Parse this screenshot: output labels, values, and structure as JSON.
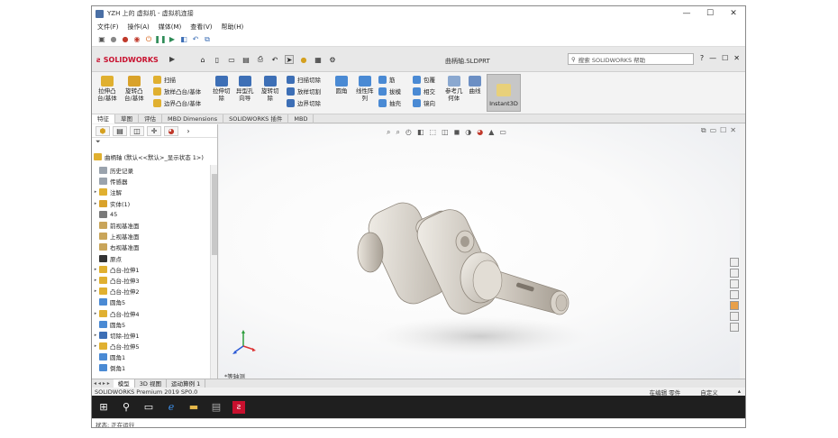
{
  "window": {
    "title": "YZH 上的 虚拟机 - 虚拟机连接",
    "controls": [
      "—",
      "☐",
      "✕"
    ]
  },
  "vm_menu": [
    "文件(F)",
    "操作(A)",
    "媒体(M)",
    "查看(V)",
    "帮助(H)"
  ],
  "sw": {
    "brand": "SOLIDWORKS",
    "document_title": "曲柄轴.SLDPRT",
    "search_placeholder": "搜索 SOLIDWORKS 帮助",
    "help_controls": [
      "?",
      "—",
      "☐",
      "✕"
    ]
  },
  "ribbon": {
    "boss_extrude": "拉伸凸\n台/基体",
    "boss_revolve": "旋转凸\n台/基体",
    "sweep": "扫描",
    "loft": "放样凸台/基体",
    "boundary": "边界凸台/基体",
    "cut_extrude": "拉伸切\n除",
    "hole_wizard": "异型孔\n向导",
    "cut_revolve": "旋转切\n除",
    "sweep_cut": "扫描切除",
    "loft_cut": "放样切割",
    "boundary_cut": "边界切除",
    "fillet": "圆角",
    "linear_pattern": "线性阵\n列",
    "rib": "筋",
    "draft": "拔模",
    "shell": "抽壳",
    "wrap": "包覆",
    "intersect": "相交",
    "mirror": "镜向",
    "reference_geometry": "参考几\n何体",
    "curves": "曲线",
    "instant3d": "Instant3D"
  },
  "tabs": [
    "特征",
    "草图",
    "评估",
    "MBD Dimensions",
    "SOLIDWORKS 插件",
    "MBD"
  ],
  "tree": {
    "filter_icon": "funnel-icon",
    "root": "曲柄轴 (默认<<默认>_显示状态 1>)",
    "items": [
      {
        "label": "历史记录",
        "expand": false
      },
      {
        "label": "传感器",
        "expand": false
      },
      {
        "label": "注解",
        "expand": true
      },
      {
        "label": "实体(1)",
        "expand": true
      },
      {
        "label": "45",
        "expand": false
      },
      {
        "label": "前视基准面",
        "expand": false
      },
      {
        "label": "上视基准面",
        "expand": false
      },
      {
        "label": "右视基准面",
        "expand": false
      },
      {
        "label": "原点",
        "expand": false
      },
      {
        "label": "凸台-拉伸1",
        "expand": true
      },
      {
        "label": "凸台-拉伸3",
        "expand": true
      },
      {
        "label": "凸台-拉伸2",
        "expand": true
      },
      {
        "label": "圆角5",
        "expand": false
      },
      {
        "label": "凸台-拉伸4",
        "expand": true
      },
      {
        "label": "圆角5",
        "expand": false
      },
      {
        "label": "切除-拉伸1",
        "expand": true
      },
      {
        "label": "凸台-拉伸5",
        "expand": true
      },
      {
        "label": "圆角1",
        "expand": false
      },
      {
        "label": "倒角1",
        "expand": false
      }
    ]
  },
  "viewport": {
    "view_label": "*等轴测"
  },
  "bottom_tabs": {
    "nav": "◂ ◂ ▸ ▸",
    "tabs": [
      "模型",
      "3D 视图",
      "运动算例 1"
    ]
  },
  "status": {
    "left": "SOLIDWORKS Premium 2019 SP0.0",
    "mode": "在编辑 零件",
    "custom": "自定义",
    "arrow": "▴"
  },
  "vm_status": "状态: 正在运行",
  "colors": {
    "accent_red": "#c8102e",
    "feature_yellow": "#e0b030",
    "feature_blue": "#3d6fb6",
    "part_gray": "#d9d4cd"
  }
}
